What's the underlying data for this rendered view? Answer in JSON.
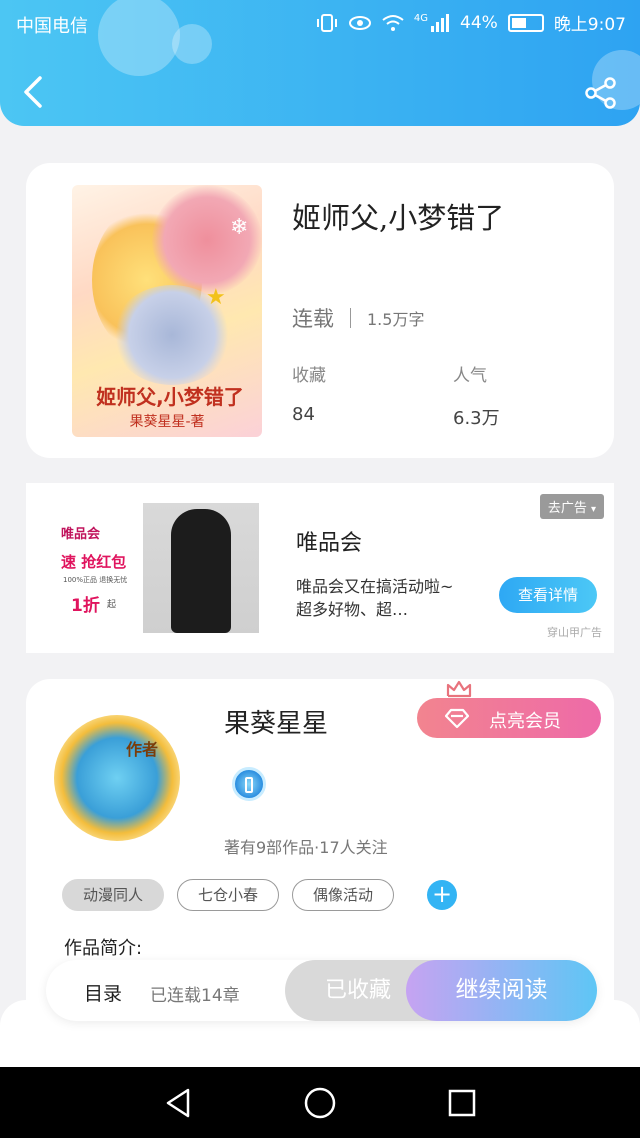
{
  "status_bar": {
    "carrier": "中国电信",
    "network": "4G",
    "battery": "44%",
    "time": "晚上9:07"
  },
  "header": {
    "back_icon": "back-arrow-icon",
    "share_icon": "share-icon"
  },
  "book": {
    "title": "姬师父,小梦错了",
    "cover_title": "姬师父,小梦错了",
    "cover_author": "果葵星星-著",
    "status": "连载",
    "word_count": "1.5万字",
    "collect_label": "收藏",
    "collect_value": "84",
    "popularity_label": "人气",
    "popularity_value": "6.3万"
  },
  "ad": {
    "tag": "去广告",
    "title": "唯品会",
    "description": "唯品会又在搞活动啦~超多好物、超…",
    "button": "查看详情",
    "source": "穿山甲广告",
    "image_text": {
      "brand": "唯品会",
      "line1": "速 抢红包",
      "line2": "100%正品 退换无忧",
      "discount": "1折",
      "suffix": "起"
    }
  },
  "author": {
    "badge": "作者",
    "name": "果葵星星",
    "vip_button": "点亮会员",
    "meta": "著有9部作品·17人关注",
    "tags": [
      "动漫同人",
      "七仓小春",
      "偶像活动"
    ],
    "intro_label": "作品简介:"
  },
  "actions": {
    "toc": "目录",
    "toc_count": "已连载14章",
    "collected": "已收藏",
    "read": "继续阅读"
  },
  "colors": {
    "header_start": "#4cc6f3",
    "header_end": "#2ea3f2",
    "vip_start": "#f2848f",
    "vip_end": "#ee6aa8",
    "read_start": "#c6a3f2",
    "read_end": "#5ec6f5",
    "accent": "#33b4f4"
  }
}
